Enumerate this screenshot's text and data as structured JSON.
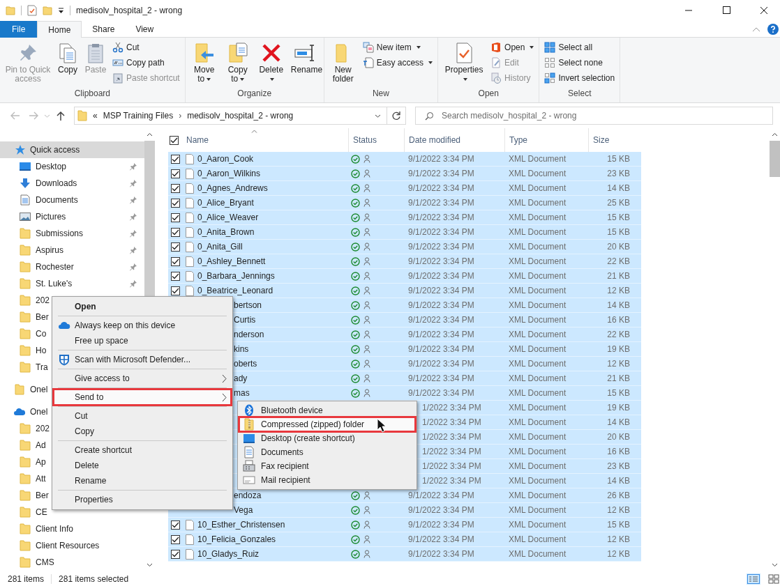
{
  "window": {
    "title": "medisolv_hospital_2 - wrong"
  },
  "tabs": [
    {
      "label": "File",
      "kind": "file",
      "selected": false
    },
    {
      "label": "Home",
      "kind": "tab",
      "selected": true
    },
    {
      "label": "Share",
      "kind": "tab",
      "selected": false
    },
    {
      "label": "View",
      "kind": "tab",
      "selected": false
    }
  ],
  "ribbon": {
    "groups": [
      {
        "label": "Clipboard",
        "large": [
          {
            "label": "Pin to Quick access",
            "kind": "pin",
            "disabled": true,
            "dropdown": false
          },
          {
            "label": "Copy",
            "kind": "copy",
            "disabled": false,
            "dropdown": false
          },
          {
            "label": "Paste",
            "kind": "paste",
            "disabled": true,
            "dropdown": false
          }
        ],
        "small": [
          {
            "label": "Cut",
            "kind": "cut",
            "disabled": false,
            "dropdown": false
          },
          {
            "label": "Copy path",
            "kind": "copy-path",
            "disabled": false,
            "dropdown": false
          },
          {
            "label": "Paste shortcut",
            "kind": "paste-shortcut",
            "disabled": true,
            "dropdown": false
          }
        ]
      },
      {
        "label": "Organize",
        "large": [
          {
            "label": "Move to",
            "kind": "move",
            "disabled": false,
            "dropdown": true
          },
          {
            "label": "Copy to",
            "kind": "copy-to",
            "disabled": false,
            "dropdown": true
          },
          {
            "label": "Delete",
            "kind": "delete",
            "disabled": false,
            "dropdown": true
          },
          {
            "label": "Rename",
            "kind": "rename",
            "disabled": false,
            "dropdown": false
          }
        ]
      },
      {
        "label": "New",
        "large": [
          {
            "label": "New folder",
            "kind": "new-folder",
            "disabled": false,
            "dropdown": false
          }
        ],
        "small": [
          {
            "label": "New item",
            "kind": "new-item",
            "disabled": false,
            "dropdown": true
          },
          {
            "label": "Easy access",
            "kind": "easy-access",
            "disabled": false,
            "dropdown": true
          }
        ]
      },
      {
        "label": "Open",
        "large": [
          {
            "label": "Properties",
            "kind": "properties",
            "disabled": false,
            "dropdown": true
          }
        ],
        "small": [
          {
            "label": "Open",
            "kind": "office",
            "disabled": false,
            "dropdown": true
          },
          {
            "label": "Edit",
            "kind": "edit",
            "disabled": true,
            "dropdown": false
          },
          {
            "label": "History",
            "kind": "history",
            "disabled": true,
            "dropdown": false
          }
        ]
      },
      {
        "label": "Select",
        "small": [
          {
            "label": "Select all",
            "kind": "select-all",
            "disabled": false,
            "dropdown": false
          },
          {
            "label": "Select none",
            "kind": "select-none",
            "disabled": false,
            "dropdown": false
          },
          {
            "label": "Invert selection",
            "kind": "invert",
            "disabled": false,
            "dropdown": false
          }
        ]
      }
    ]
  },
  "address": {
    "prefix": "«",
    "path": [
      "MSP Training Files",
      "medisolv_hospital_2 - wrong"
    ],
    "separator": "›"
  },
  "search": {
    "placeholder": "Search medisolv_hospital_2 - wrong"
  },
  "nav": [
    {
      "label": "Quick access",
      "kind": "quick-access",
      "selected": true,
      "children": [
        {
          "label": "Desktop",
          "kind": "desktop",
          "selected": false,
          "pinned": true
        },
        {
          "label": "Downloads",
          "kind": "downloads",
          "selected": false,
          "pinned": true
        },
        {
          "label": "Documents",
          "kind": "documents",
          "selected": false,
          "pinned": true
        },
        {
          "label": "Pictures",
          "kind": "pictures",
          "selected": false,
          "pinned": true
        },
        {
          "label": "Submissions",
          "kind": "folder",
          "selected": false,
          "pinned": true
        },
        {
          "label": "Aspirus",
          "kind": "folder",
          "selected": false,
          "pinned": true
        },
        {
          "label": "Rochester",
          "kind": "folder",
          "selected": false,
          "pinned": true
        },
        {
          "label": "St. Luke's",
          "kind": "folder",
          "selected": false,
          "pinned": true
        },
        {
          "label": "202",
          "kind": "folder",
          "selected": false,
          "pinned": false
        },
        {
          "label": "Ber",
          "kind": "folder",
          "selected": false,
          "pinned": false
        },
        {
          "label": "Co",
          "kind": "folder",
          "selected": false,
          "pinned": false
        },
        {
          "label": "Ho",
          "kind": "folder",
          "selected": false,
          "pinned": false
        },
        {
          "label": "Tra",
          "kind": "folder",
          "selected": false,
          "pinned": false
        }
      ]
    },
    {
      "label": "Onel",
      "kind": "folder",
      "selected": false
    },
    {
      "label": "Onel",
      "kind": "onedrive",
      "selected": false,
      "children": [
        {
          "label": "202",
          "kind": "folder",
          "selected": false,
          "pinned": false
        },
        {
          "label": "Ad",
          "kind": "folder",
          "selected": false,
          "pinned": false
        },
        {
          "label": "Ap",
          "kind": "folder",
          "selected": false,
          "pinned": false
        },
        {
          "label": "Att",
          "kind": "folder",
          "selected": false,
          "pinned": false
        },
        {
          "label": "Ber",
          "kind": "folder",
          "selected": false,
          "pinned": false
        },
        {
          "label": "CE",
          "kind": "folder",
          "selected": false,
          "pinned": false
        },
        {
          "label": "Client Info",
          "kind": "folder",
          "selected": false,
          "pinned": false
        },
        {
          "label": "Client Resources",
          "kind": "folder",
          "selected": false,
          "pinned": false
        },
        {
          "label": "CMS",
          "kind": "folder",
          "selected": false,
          "pinned": false
        }
      ]
    }
  ],
  "table": {
    "header_checked": true,
    "columns": [
      "Name",
      "Status",
      "Date modified",
      "Type",
      "Size"
    ],
    "rows": [
      {
        "name": "0_Aaron_Cook",
        "kind": "full",
        "checked": true,
        "selected": true,
        "date": "9/1/2022 3:34 PM",
        "type": "XML Document",
        "size": "15 KB"
      },
      {
        "name": "0_Aaron_Wilkins",
        "kind": "full",
        "checked": true,
        "selected": true,
        "date": "9/1/2022 3:34 PM",
        "type": "XML Document",
        "size": "23 KB"
      },
      {
        "name": "0_Agnes_Andrews",
        "kind": "full",
        "checked": true,
        "selected": true,
        "date": "9/1/2022 3:34 PM",
        "type": "XML Document",
        "size": "14 KB"
      },
      {
        "name": "0_Alice_Bryant",
        "kind": "full",
        "checked": true,
        "selected": true,
        "date": "9/1/2022 3:34 PM",
        "type": "XML Document",
        "size": "25 KB"
      },
      {
        "name": "0_Alice_Weaver",
        "kind": "full",
        "checked": true,
        "selected": true,
        "date": "9/1/2022 3:34 PM",
        "type": "XML Document",
        "size": "15 KB"
      },
      {
        "name": "0_Anita_Brown",
        "kind": "full",
        "checked": true,
        "selected": true,
        "date": "9/1/2022 3:34 PM",
        "type": "XML Document",
        "size": "15 KB"
      },
      {
        "name": "0_Anita_Gill",
        "kind": "full",
        "checked": true,
        "selected": true,
        "date": "9/1/2022 3:34 PM",
        "type": "XML Document",
        "size": "20 KB"
      },
      {
        "name": "0_Ashley_Bennett",
        "kind": "full",
        "checked": true,
        "selected": true,
        "date": "9/1/2022 3:34 PM",
        "type": "XML Document",
        "size": "22 KB"
      },
      {
        "name": "0_Barbara_Jennings",
        "kind": "full",
        "checked": true,
        "selected": true,
        "date": "9/1/2022 3:34 PM",
        "type": "XML Document",
        "size": "21 KB"
      },
      {
        "name": "0_Beatrice_Leonard",
        "kind": "full",
        "checked": true,
        "selected": true,
        "date": "9/1/2022 3:34 PM",
        "type": "XML Document",
        "size": "12 KB"
      },
      {
        "name": "bertson",
        "kind": "partial",
        "selected": true,
        "date": "9/1/2022 3:34 PM",
        "type": "XML Document",
        "size": "14 KB"
      },
      {
        "name": "Curtis",
        "kind": "partial",
        "selected": true,
        "date": "9/1/2022 3:34 PM",
        "type": "XML Document",
        "size": "16 KB"
      },
      {
        "name": "nderson",
        "kind": "partial",
        "selected": true,
        "date": "9/1/2022 3:34 PM",
        "type": "XML Document",
        "size": "22 KB"
      },
      {
        "name": "kins",
        "kind": "partial",
        "selected": true,
        "date": "9/1/2022 3:34 PM",
        "type": "XML Document",
        "size": "19 KB"
      },
      {
        "name": "oberts",
        "kind": "partial",
        "selected": true,
        "date": "9/1/2022 3:34 PM",
        "type": "XML Document",
        "size": "12 KB"
      },
      {
        "name": "ady",
        "kind": "partial",
        "selected": true,
        "date": "9/1/2022 3:34 PM",
        "type": "XML Document",
        "size": "21 KB"
      },
      {
        "name": "mas",
        "kind": "partial",
        "selected": true,
        "date": "9/1/2022 3:34 PM",
        "type": "XML Document",
        "size": "15 KB"
      },
      {
        "kind": "hidden",
        "selected": true,
        "date": "1/2022 3:34 PM",
        "type": "XML Document",
        "size": "19 KB"
      },
      {
        "kind": "hidden",
        "selected": true,
        "date": "1/2022 3:34 PM",
        "type": "XML Document",
        "size": "14 KB"
      },
      {
        "kind": "hidden",
        "selected": true,
        "date": "1/2022 3:34 PM",
        "type": "XML Document",
        "size": "20 KB"
      },
      {
        "kind": "hidden",
        "selected": true,
        "date": "1/2022 3:34 PM",
        "type": "XML Document",
        "size": "16 KB"
      },
      {
        "kind": "hidden",
        "selected": true,
        "date": "1/2022 3:34 PM",
        "type": "XML Document",
        "size": "23 KB"
      },
      {
        "kind": "hidden",
        "selected": true,
        "date": "1/2022 3:34 PM",
        "type": "XML Document",
        "size": "14 KB"
      },
      {
        "name": "endoza",
        "kind": "partial",
        "selected": true,
        "date": "9/1/2022 3:34 PM",
        "type": "XML Document",
        "size": "26 KB"
      },
      {
        "name": "Vega",
        "kind": "partial",
        "selected": true,
        "date": "9/1/2022 3:34 PM",
        "type": "XML Document",
        "size": "12 KB"
      },
      {
        "name": "10_Esther_Christensen",
        "kind": "full",
        "checked": true,
        "selected": true,
        "date": "9/1/2022 3:34 PM",
        "type": "XML Document",
        "size": "15 KB"
      },
      {
        "name": "10_Felicia_Gonzales",
        "kind": "full",
        "checked": true,
        "selected": true,
        "date": "9/1/2022 3:34 PM",
        "type": "XML Document",
        "size": "12 KB"
      },
      {
        "name": "10_Gladys_Ruiz",
        "kind": "full",
        "checked": true,
        "selected": true,
        "date": "9/1/2022 3:34 PM",
        "type": "XML Document",
        "size": "12 KB"
      }
    ]
  },
  "context_menu": {
    "groups": [
      [
        {
          "label": "Open",
          "kind": "plain",
          "bold": true,
          "submenu": false,
          "highlighted": false
        }
      ],
      [
        {
          "label": "Always keep on this device",
          "kind": "cloud",
          "bold": false,
          "submenu": false,
          "highlighted": false
        },
        {
          "label": "Free up space",
          "kind": "plain",
          "bold": false,
          "submenu": false,
          "highlighted": false
        }
      ],
      [
        {
          "label": "Scan with Microsoft Defender...",
          "kind": "shield",
          "bold": false,
          "submenu": false,
          "highlighted": false
        }
      ],
      [
        {
          "label": "Give access to",
          "kind": "plain",
          "bold": false,
          "submenu": true,
          "highlighted": false
        }
      ],
      [
        {
          "label": "Send to",
          "kind": "plain",
          "bold": false,
          "submenu": true,
          "highlighted": true
        }
      ],
      [
        {
          "label": "Cut",
          "kind": "plain",
          "bold": false,
          "submenu": false,
          "highlighted": false
        },
        {
          "label": "Copy",
          "kind": "plain",
          "bold": false,
          "submenu": false,
          "highlighted": false
        }
      ],
      [
        {
          "label": "Create shortcut",
          "kind": "plain",
          "bold": false,
          "submenu": false,
          "highlighted": false
        },
        {
          "label": "Delete",
          "kind": "plain",
          "bold": false,
          "submenu": false,
          "highlighted": false
        },
        {
          "label": "Rename",
          "kind": "plain",
          "bold": false,
          "submenu": false,
          "highlighted": false
        }
      ],
      [
        {
          "label": "Properties",
          "kind": "plain",
          "bold": false,
          "submenu": false,
          "highlighted": false
        }
      ]
    ]
  },
  "send_to_menu": {
    "items": [
      {
        "label": "Bluetooth device",
        "kind": "bluetooth",
        "highlighted": false
      },
      {
        "label": "Compressed (zipped) folder",
        "kind": "zip",
        "highlighted": true
      },
      {
        "label": "Desktop (create shortcut)",
        "kind": "desktop",
        "highlighted": false
      },
      {
        "label": "Documents",
        "kind": "documents",
        "highlighted": false
      },
      {
        "label": "Fax recipient",
        "kind": "fax",
        "highlighted": false
      },
      {
        "label": "Mail recipient",
        "kind": "mail",
        "highlighted": false
      }
    ]
  },
  "status_bar": {
    "count": "281 items",
    "selection": "281 items selected",
    "views": [
      {
        "kind": "details",
        "selected": true
      },
      {
        "kind": "large-icons",
        "selected": false
      }
    ]
  }
}
